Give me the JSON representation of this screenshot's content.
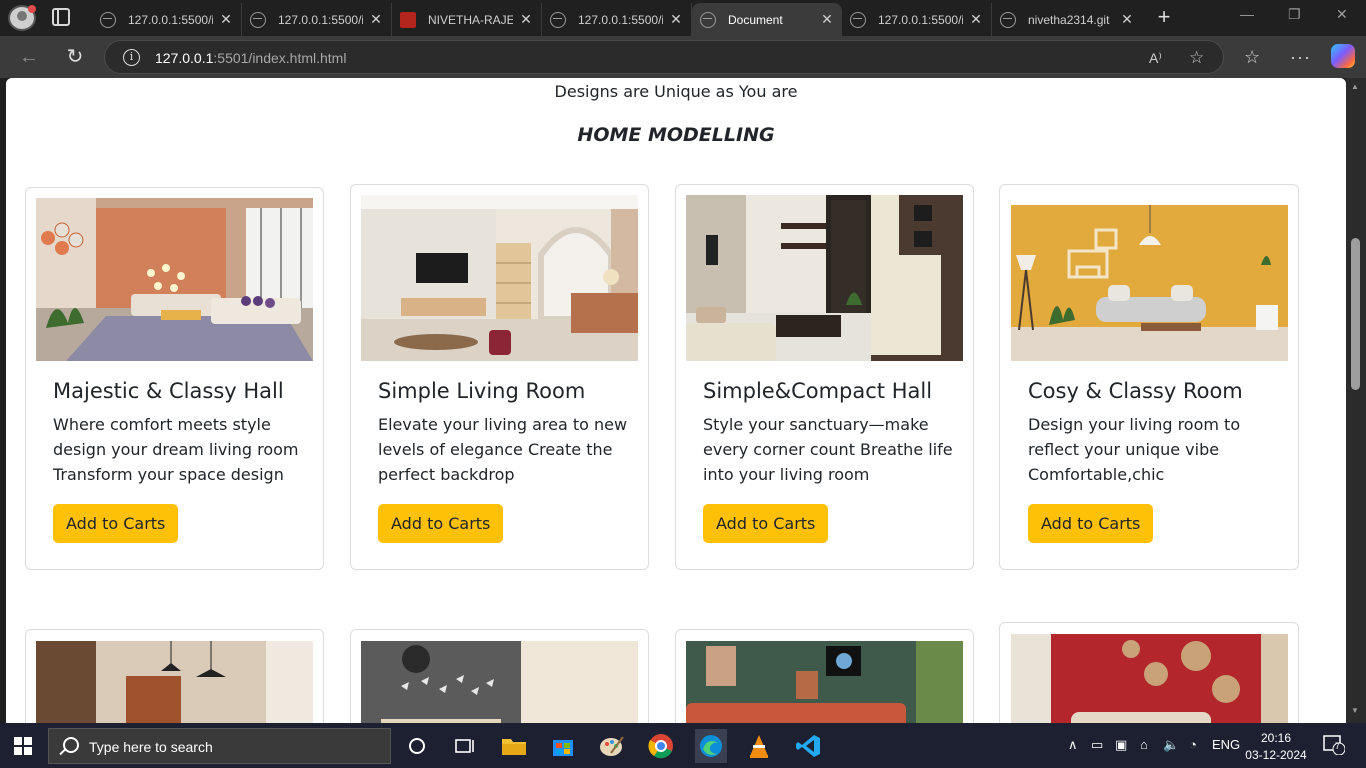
{
  "browser": {
    "tabs": [
      {
        "label": "127.0.0.1:5500/i",
        "icon": "globe-icon"
      },
      {
        "label": "127.0.0.1:5500/i",
        "icon": "globe-icon"
      },
      {
        "label": "NIVETHA-RAJEN",
        "icon": "pdf-icon"
      },
      {
        "label": "127.0.0.1:5500/i",
        "icon": "globe-icon"
      },
      {
        "label": "Document",
        "icon": "globe-icon",
        "active": true
      },
      {
        "label": "127.0.0.1:5500/i",
        "icon": "globe-icon"
      },
      {
        "label": "nivetha2314.git",
        "icon": "globe-icon"
      }
    ],
    "url_host": "127.0.0.1",
    "url_rest": ":5501/index.html.html"
  },
  "page": {
    "tagline": "Designs are Unique as You are",
    "section_title": "HOME MODELLING",
    "cards": [
      {
        "title": "Majestic & Classy Hall",
        "text": "Where comfort meets style design your dream living room Transform your space design",
        "button": "Add to Carts"
      },
      {
        "title": "Simple Living Room",
        "text": "Elevate your living area to new levels of elegance Create the perfect backdrop",
        "button": "Add to Carts"
      },
      {
        "title": "Simple&Compact Hall",
        "text": "Style your sanctuary—make every corner count Breathe life into your living room",
        "button": "Add to Carts"
      },
      {
        "title": "Cosy & Classy Room",
        "text": "Design your living room to reflect your unique vibe Comfortable,chic",
        "button": "Add to Carts"
      }
    ]
  },
  "taskbar": {
    "search_placeholder": "Type here to search",
    "language": "ENG",
    "time": "20:16",
    "date": "03-12-2024",
    "notification_count": "7"
  },
  "colors": {
    "button": "#ffc107",
    "browser_bg": "#202020",
    "taskbar_bg": "#1c2030"
  }
}
